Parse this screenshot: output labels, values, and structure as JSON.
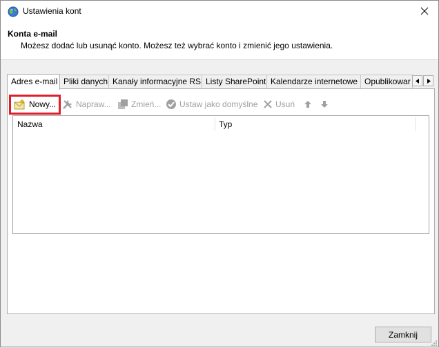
{
  "window": {
    "title": "Ustawienia kont"
  },
  "header": {
    "title": "Konta e-mail",
    "description": "Możesz dodać lub usunąć konto. Możesz też wybrać konto i zmienić jego ustawienia."
  },
  "tabs": [
    {
      "label": "Adres e-mail",
      "active": true
    },
    {
      "label": "Pliki danych"
    },
    {
      "label": "Kanały informacyjne RSS"
    },
    {
      "label": "Listy SharePoint"
    },
    {
      "label": "Kalendarze internetowe"
    },
    {
      "label": "Opublikowar"
    }
  ],
  "toolbar": {
    "new_label": "Nowy...",
    "repair_label": "Napraw...",
    "change_label": "Zmień...",
    "set_default_label": "Ustaw jako domyślne",
    "remove_label": "Usuń"
  },
  "list": {
    "columns": [
      "Nazwa",
      "Typ"
    ]
  },
  "footer": {
    "close_label": "Zamknij"
  },
  "colors": {
    "highlight": "#e01e2a",
    "disabled": "#a0a0a0",
    "border": "#adadad"
  }
}
